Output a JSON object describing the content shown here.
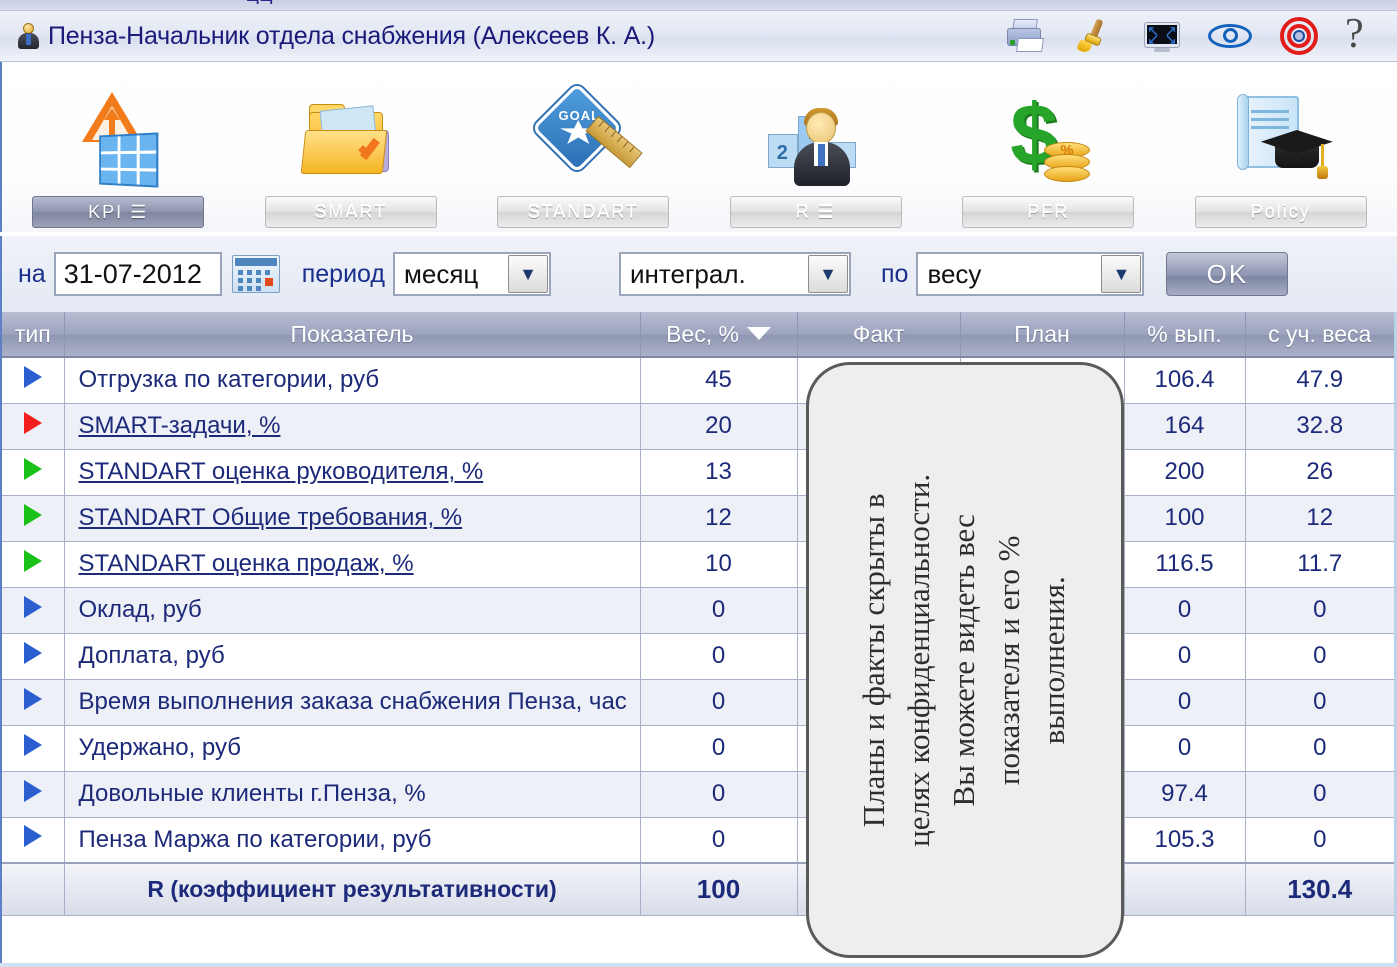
{
  "topfragment": "щщ",
  "titlebar": {
    "user_icon": "user-icon",
    "title": "Пенза-Начальник отдела снабжения  (Алексеев К. А.)",
    "icons": [
      {
        "name": "print-icon",
        "label": "Печать"
      },
      {
        "name": "brush-icon",
        "label": "Очистить"
      },
      {
        "name": "fullscreen-icon",
        "label": "Полный экран"
      },
      {
        "name": "eye-icon",
        "label": "Просмотр"
      },
      {
        "name": "target-icon",
        "label": "Цель"
      },
      {
        "name": "help-icon",
        "label": "?"
      }
    ]
  },
  "nav": {
    "items": [
      {
        "label": "KPI  ☰",
        "icon": "kpi-warning-grid-icon",
        "active": true
      },
      {
        "label": "SMART",
        "icon": "folder-task-icon",
        "active": false
      },
      {
        "label": "STANDART",
        "icon": "goal-badge-ruler-icon",
        "active": false
      },
      {
        "label": "R  ☰",
        "icon": "podium-person-icon",
        "active": false
      },
      {
        "label": "PFR",
        "icon": "dollar-coins-icon",
        "active": false
      },
      {
        "label": "Policy",
        "icon": "scroll-graduation-cap-icon",
        "active": false
      }
    ],
    "active_underline_color": "#fb2323"
  },
  "filters": {
    "date_label": "на",
    "date_value": "31-07-2012",
    "calendar_icon": "calendar-icon",
    "period_label": "период",
    "period_value": "месяц",
    "mode_value": "интеграл.",
    "by_label": "по",
    "by_value": "весу",
    "ok_label": "OK"
  },
  "table": {
    "columns": [
      "тип",
      "Показатель",
      "Вес, %",
      "Факт",
      "План",
      "% вып.",
      "с уч. веса"
    ],
    "sorted_column": "Вес, %",
    "sort_direction": "desc",
    "rows": [
      {
        "marker": "blue",
        "name": "Отгрузка по категории, руб",
        "link": false,
        "weight": "45",
        "fact": "",
        "plan": "",
        "pct": "106.4",
        "weighted": "47.9"
      },
      {
        "marker": "red",
        "name": "SMART-задачи, %",
        "link": true,
        "weight": "20",
        "fact": "",
        "plan": "",
        "pct": "164",
        "weighted": "32.8"
      },
      {
        "marker": "green",
        "name": "STANDART оценка руководителя, %",
        "link": true,
        "weight": "13",
        "fact": "",
        "plan": "",
        "pct": "200",
        "weighted": "26"
      },
      {
        "marker": "green",
        "name": "STANDART Общие требования, %",
        "link": true,
        "weight": "12",
        "fact": "",
        "plan": "",
        "pct": "100",
        "weighted": "12"
      },
      {
        "marker": "green",
        "name": "STANDART оценка продаж, %",
        "link": true,
        "weight": "10",
        "fact": "",
        "plan": "",
        "pct": "116.5",
        "weighted": "11.7"
      },
      {
        "marker": "blue",
        "name": "Оклад, руб",
        "link": false,
        "weight": "0",
        "fact": "",
        "plan": "",
        "pct": "0",
        "weighted": "0"
      },
      {
        "marker": "blue",
        "name": "Доплата, руб",
        "link": false,
        "weight": "0",
        "fact": "",
        "plan": "",
        "pct": "0",
        "weighted": "0"
      },
      {
        "marker": "blue",
        "name": "Время выполнения заказа снабжения Пенза, час",
        "link": false,
        "weight": "0",
        "fact": "",
        "plan": "",
        "pct": "0",
        "weighted": "0"
      },
      {
        "marker": "blue",
        "name": "Удержано, руб",
        "link": false,
        "weight": "0",
        "fact": "",
        "plan": "",
        "pct": "0",
        "weighted": "0"
      },
      {
        "marker": "blue",
        "name": "Довольные клиенты г.Пенза, %",
        "link": false,
        "weight": "0",
        "fact": "",
        "plan": "",
        "pct": "97.4",
        "weighted": "0"
      },
      {
        "marker": "blue",
        "name": "Пенза Маржа по категории, руб",
        "link": false,
        "weight": "0",
        "fact": "",
        "plan": "",
        "pct": "105.3",
        "weighted": "0"
      }
    ],
    "footer": {
      "label": "R (коэффициент результативности)",
      "weight_total": "100",
      "fact": "",
      "plan": "",
      "pct": "",
      "weighted_total": "130.4"
    }
  },
  "callout": {
    "text": "Планы и факты скрыты в целях конфиденциальности. Вы можете видеть вес показателя и его % выполнения.",
    "lines": [
      "Планы и факты скрыты в",
      "целях конфиденциальности.",
      "Вы можете видеть вес",
      "показателя и его %",
      "выполнения."
    ]
  }
}
